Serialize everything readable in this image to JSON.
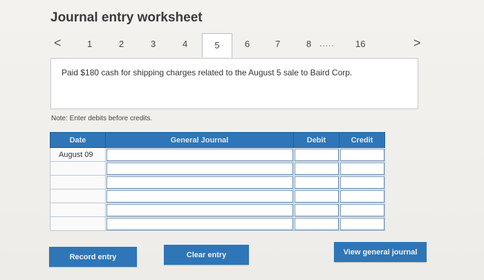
{
  "worksheet": {
    "title": "Journal entry worksheet"
  },
  "pager": {
    "prev_symbol": "<",
    "next_symbol": ">",
    "pages": [
      "1",
      "2",
      "3",
      "4",
      "5",
      "6",
      "7",
      "8",
      "16"
    ],
    "ellipsis": ".....",
    "active": "5"
  },
  "prompt": {
    "text": "Paid $180 cash for shipping charges related to the August 5 sale to Baird Corp."
  },
  "note": "Note: Enter debits before credits.",
  "table": {
    "headers": {
      "date": "Date",
      "journal": "General Journal",
      "debit": "Debit",
      "credit": "Credit"
    },
    "rows": [
      {
        "date": "August 09"
      },
      {
        "date": ""
      },
      {
        "date": ""
      },
      {
        "date": ""
      },
      {
        "date": ""
      },
      {
        "date": ""
      }
    ]
  },
  "buttons": {
    "record": "Record entry",
    "clear": "Clear entry",
    "view": "View general journal"
  },
  "colors": {
    "accent": "#2e76b7",
    "header_border": "#1d5e99"
  }
}
